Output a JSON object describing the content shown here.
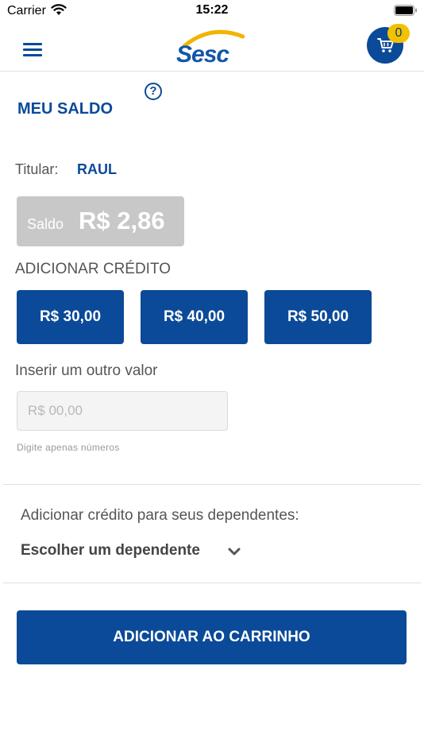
{
  "status_bar": {
    "carrier": "Carrier",
    "time": "15:22"
  },
  "header": {
    "logo_text": "Sesc",
    "cart_count": "0"
  },
  "page": {
    "title": "MEU SALDO"
  },
  "holder": {
    "label": "Titular:",
    "name": "RAUL"
  },
  "balance": {
    "label": "Saldo",
    "value": "R$ 2,86"
  },
  "add_credit": {
    "title": "ADICIONAR CRÉDITO",
    "amounts": [
      "R$ 30,00",
      "R$ 40,00",
      "R$ 50,00"
    ],
    "other_value_label": "Inserir um outro valor",
    "input_placeholder": "R$ 00,00",
    "input_hint": "Digite apenas números"
  },
  "dependents": {
    "label": "Adicionar crédito para seus dependentes:",
    "select_text": "Escolher um dependente"
  },
  "actions": {
    "add_to_cart": "ADICIONAR AO CARRINHO"
  },
  "icons": [
    "wifi-icon",
    "battery-icon",
    "menu-icon",
    "cart-icon",
    "help-icon",
    "chevron-down-icon"
  ],
  "colors": {
    "primary": "#0b4a98",
    "badge": "#f2c200",
    "balance_bg": "#c8c8c8",
    "logo_arc": "#f2b400"
  }
}
